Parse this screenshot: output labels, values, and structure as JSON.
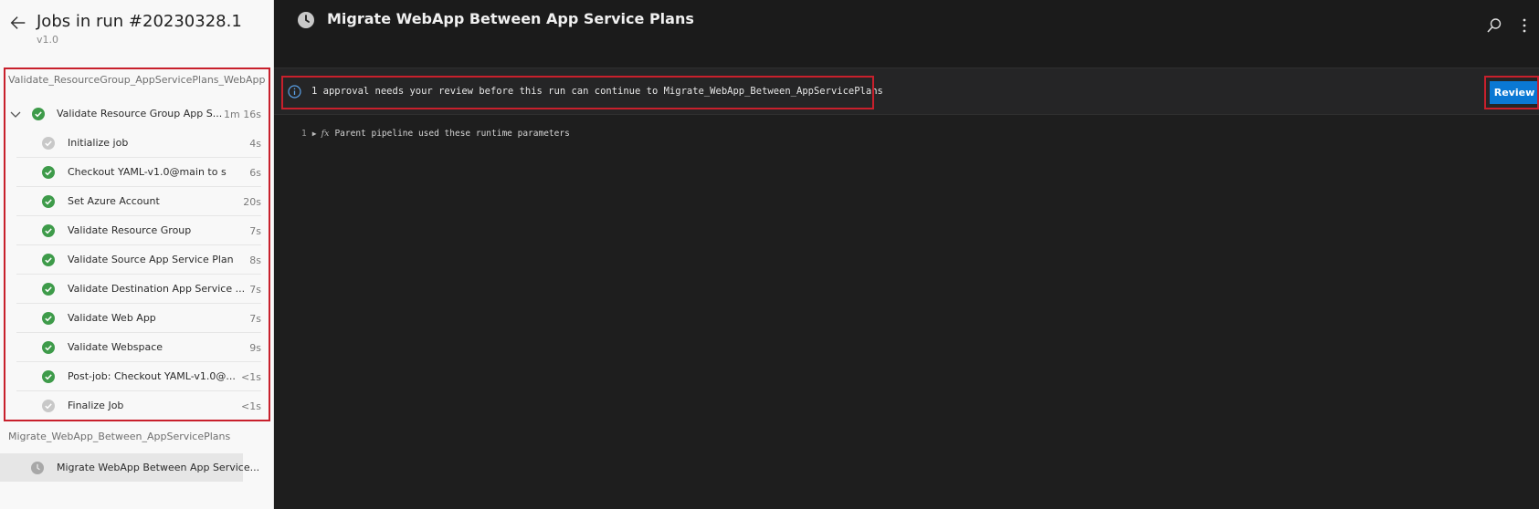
{
  "panel": {
    "title": "Jobs in run #20230328.1",
    "version": "v1.0"
  },
  "stages": [
    {
      "name": "Validate_ResourceGroup_AppServicePlans_WebApp",
      "job": {
        "name": "Validate Resource Group App S...",
        "duration": "1m 16s",
        "status": "succeeded",
        "steps": [
          {
            "name": "Initialize job",
            "duration": "4s",
            "status": "skipped"
          },
          {
            "name": "Checkout YAML-v1.0@main to s",
            "duration": "6s",
            "status": "succeeded"
          },
          {
            "name": "Set Azure Account",
            "duration": "20s",
            "status": "succeeded"
          },
          {
            "name": "Validate Resource Group",
            "duration": "7s",
            "status": "succeeded"
          },
          {
            "name": "Validate Source App Service Plan",
            "duration": "8s",
            "status": "succeeded"
          },
          {
            "name": "Validate Destination App Service ...",
            "duration": "7s",
            "status": "succeeded"
          },
          {
            "name": "Validate Web App",
            "duration": "7s",
            "status": "succeeded"
          },
          {
            "name": "Validate Webspace",
            "duration": "9s",
            "status": "succeeded"
          },
          {
            "name": "Post-job: Checkout YAML-v1.0@...",
            "duration": "<1s",
            "status": "succeeded"
          },
          {
            "name": "Finalize Job",
            "duration": "<1s",
            "status": "skipped"
          }
        ]
      }
    },
    {
      "name": "Migrate_WebApp_Between_AppServicePlans",
      "job": {
        "name": "Migrate WebApp Between App Service...",
        "status": "waiting"
      }
    }
  ],
  "main": {
    "title": "Migrate WebApp Between App Service Plans",
    "banner_text": "1 approval needs your review before this run can continue to Migrate_WebApp_Between_AppServicePlans",
    "review_label": "Review",
    "log": {
      "line_number": "1",
      "text": "Parent pipeline used these runtime parameters"
    }
  },
  "icons": {
    "back": "arrow-left-icon",
    "chevron": "chevron-down-icon",
    "succeeded": "check-circle-icon",
    "skipped": "skipped-circle-icon",
    "waiting": "clock-icon",
    "info": "info-icon",
    "search": "search-icon",
    "more": "more-vertical-icon",
    "expand": "triangle-right-icon",
    "fx": "fx-icon"
  },
  "colors": {
    "succeeded": "#3e9b4a",
    "skipped": "#c8c8c8",
    "accent": "#0a78d4",
    "highlight": "#c8202c",
    "info": "#5aa0e6"
  }
}
